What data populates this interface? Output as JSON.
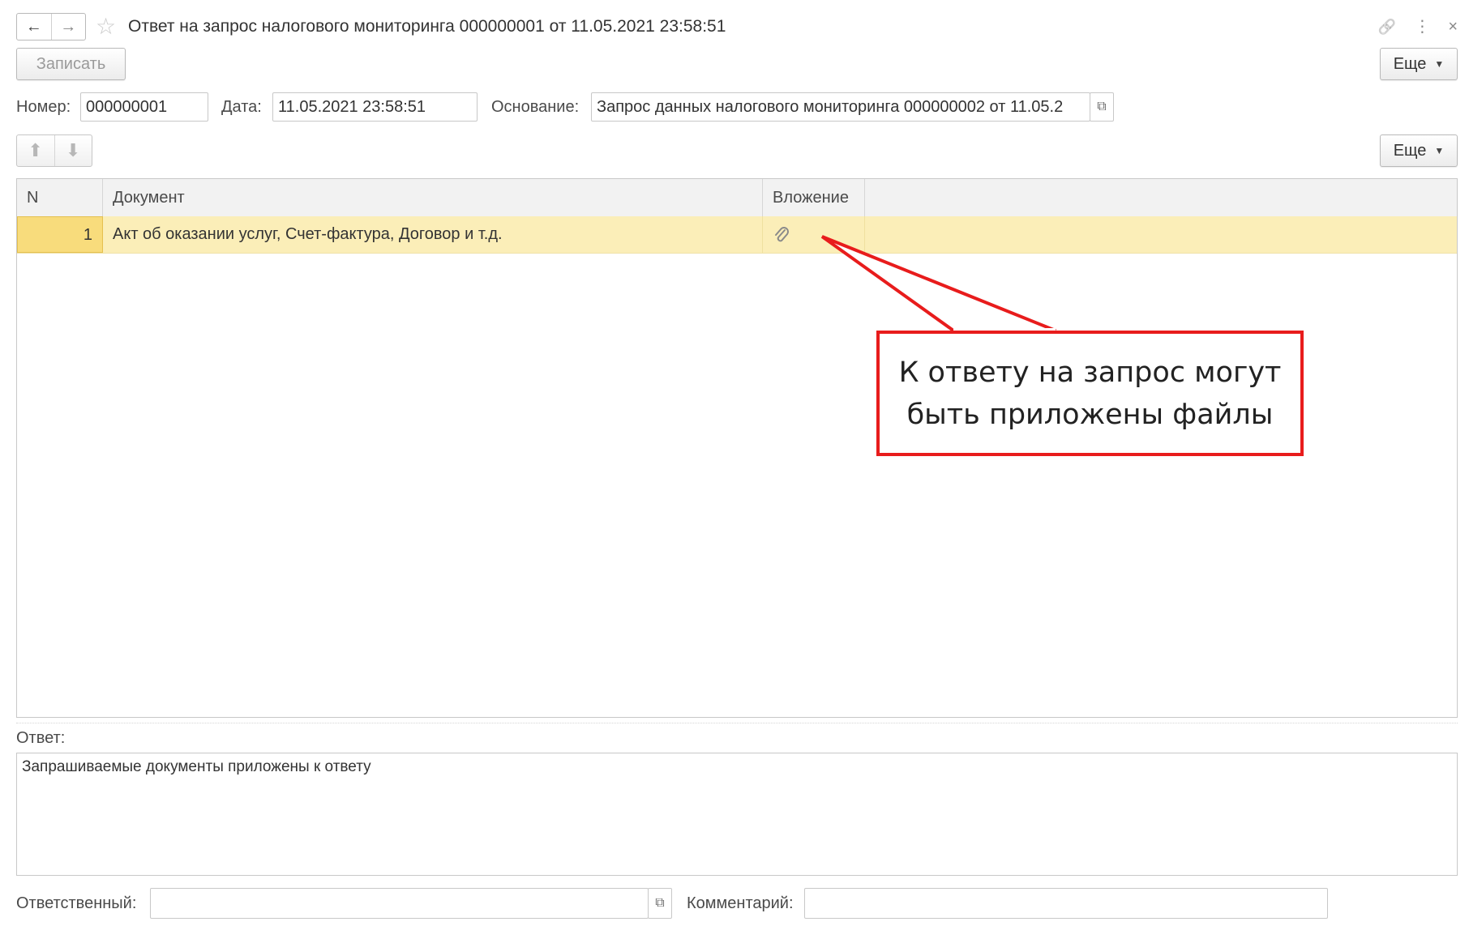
{
  "window": {
    "title": "Ответ на запрос налогового мониторинга 000000001 от 11.05.2021 23:58:51",
    "nav_back": "←",
    "nav_forward": "→",
    "star": "☆",
    "link_icon": "🔗",
    "menu_icon": "⋮",
    "close_icon": "×"
  },
  "toolbar": {
    "save_label": "Записать",
    "more_label": "Еще"
  },
  "header_fields": {
    "number_label": "Номер:",
    "number_value": "000000001",
    "date_label": "Дата:",
    "date_value": "11.05.2021 23:58:51",
    "basis_label": "Основание:",
    "basis_value": "Запрос данных налогового мониторинга 000000002 от 11.05.2"
  },
  "table_toolbar": {
    "up_icon": "⬆",
    "down_icon": "⬇",
    "more_label": "Еще"
  },
  "table": {
    "columns": [
      "N",
      "Документ",
      "Вложение"
    ],
    "rows": [
      {
        "n": "1",
        "document": "Акт об оказании услуг, Счет-фактура, Договор и т.д.",
        "attachment_icon": "paperclip"
      }
    ]
  },
  "callout": {
    "line1": "К ответу на запрос могут",
    "line2": "быть приложены файлы",
    "border_color": "#e81c1c"
  },
  "answer": {
    "label": "Ответ:",
    "value": "Запрашиваемые документы приложены к ответу"
  },
  "footer": {
    "responsible_label": "Ответственный:",
    "responsible_value": "",
    "comment_label": "Комментарий:",
    "comment_value": ""
  },
  "colors": {
    "selected_row": "#fbeeb8",
    "selected_cell": "#f8dc7c",
    "header_bg": "#f2f2f2"
  }
}
